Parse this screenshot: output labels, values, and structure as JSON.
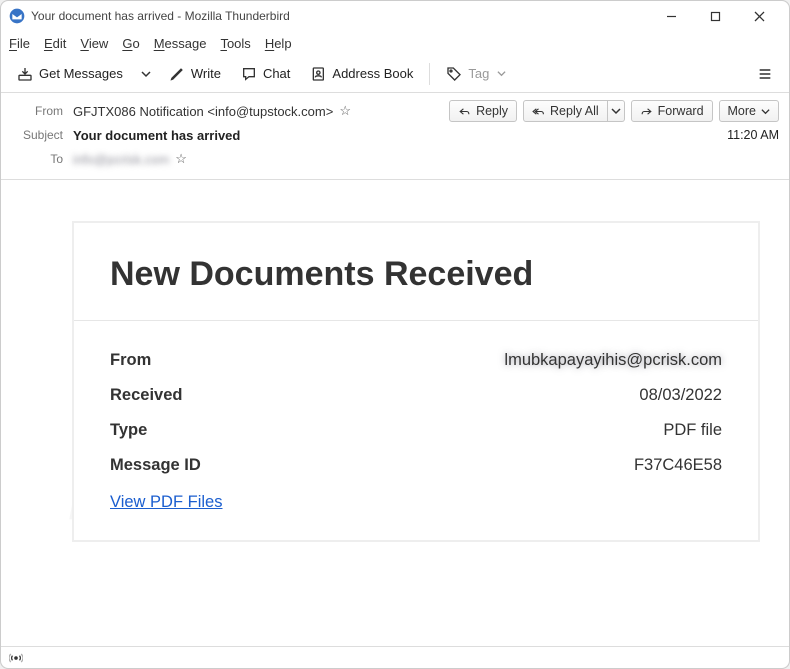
{
  "window": {
    "title": "Your document has arrived - Mozilla Thunderbird"
  },
  "menu": {
    "file": "File",
    "edit": "Edit",
    "view": "View",
    "go": "Go",
    "message": "Message",
    "tools": "Tools",
    "help": "Help"
  },
  "toolbar": {
    "get_messages": "Get Messages",
    "write": "Write",
    "chat": "Chat",
    "address_book": "Address Book",
    "tag": "Tag"
  },
  "header": {
    "from_label": "From",
    "from_value": "GFJTX086 Notification <info@tupstock.com>",
    "subject_label": "Subject",
    "subject_value": "Your document has arrived",
    "to_label": "To",
    "to_value": "info@pcrisk.com",
    "reply": "Reply",
    "reply_all": "Reply All",
    "forward": "Forward",
    "more": "More",
    "time": "11:20 AM"
  },
  "email": {
    "title": "New Documents Received",
    "rows": {
      "from_k": "From",
      "from_v": "lmubkapayayihis@pcrisk.com",
      "received_k": "Received",
      "received_v": "08/03/2022",
      "type_k": "Type",
      "type_v": "PDF file",
      "msgid_k": "Message ID",
      "msgid_v": "F37C46E58"
    },
    "link": "View PDF Files"
  }
}
